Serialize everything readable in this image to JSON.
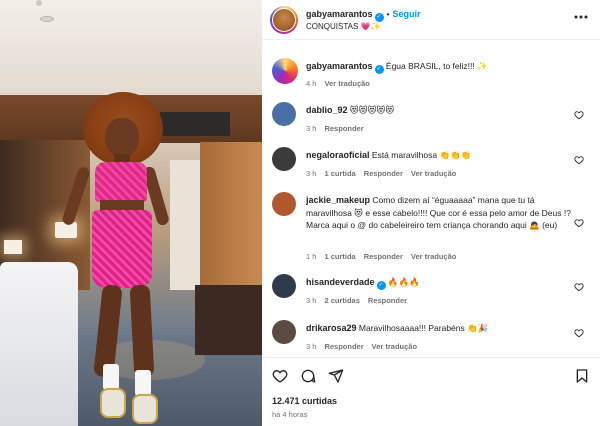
{
  "post": {
    "author": "gabyamarantos",
    "follow_label": "Seguir",
    "subtitle": "CONQUISTAS 💗✨",
    "caption": {
      "username": "gabyamarantos",
      "text": "Égua BRASIL, to feliz!!! ✨",
      "time": "4 h",
      "translate": "Ver tradução"
    },
    "likes": "12.471 curtidas",
    "posted": "há 4 horas"
  },
  "comments": [
    {
      "username": "dablio_92",
      "verified": false,
      "text": "😻😻😻😻😻",
      "time": "3 h",
      "likes": "",
      "reply": "Responder",
      "translate": "",
      "avatar_color": "#4a6fa5"
    },
    {
      "username": "negaloraoficial",
      "verified": false,
      "text": "Está maravilhosa 👏👏👏",
      "time": "3 h",
      "likes": "1 curtida",
      "reply": "Responder",
      "translate": "Ver tradução",
      "avatar_color": "#3b3b3b"
    },
    {
      "username": "jackie_makeup",
      "verified": false,
      "text": "Como dizem aí “éguaaaaa” mana que tu tá maravilhosa 😻 e esse cabelo!!!! Que cor é essa pelo amor de Deus !? Marca aqui o @ do cabeleireiro tem criança chorando aqui 🙇 (eu)",
      "time": "1 h",
      "likes": "1 curtida",
      "reply": "Responder",
      "translate": "Ver tradução",
      "avatar_color": "#b0572e"
    },
    {
      "username": "hisandeverdade",
      "verified": true,
      "text": "🔥🔥🔥",
      "time": "3 h",
      "likes": "2 curtidas",
      "reply": "Responder",
      "translate": "",
      "avatar_color": "#2f3a4a"
    },
    {
      "username": "drikarosa29",
      "verified": false,
      "text": "Maravilhosaaaa!!! Parabéns 👏🎉",
      "time": "3 h",
      "likes": "",
      "reply": "Responder",
      "translate": "Ver tradução",
      "avatar_color": "#5a4a40"
    }
  ],
  "icons": {
    "more": "more-icon",
    "heart": "heart-icon",
    "comment": "comment-icon",
    "share": "share-icon",
    "save": "bookmark-icon"
  },
  "colors": {
    "link": "#0095f6",
    "muted": "#737373",
    "text": "#262626"
  }
}
